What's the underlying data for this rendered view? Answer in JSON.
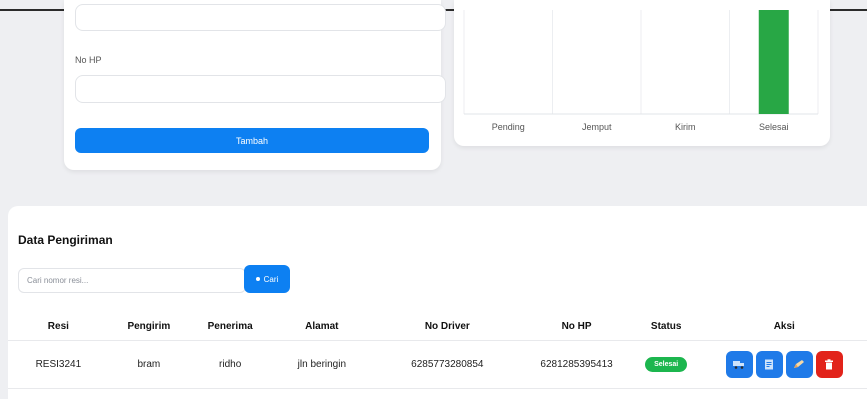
{
  "form": {
    "no_hp_label": "No HP",
    "tambah_label": "Tambah"
  },
  "chart_data": {
    "type": "bar",
    "categories": [
      "Pending",
      "Jemput",
      "Kirim",
      "Selesai"
    ],
    "values": [
      0,
      0,
      0,
      1
    ],
    "colors": [
      "#28a745",
      "#28a745",
      "#28a745",
      "#28a745"
    ],
    "title": "",
    "xlabel": "",
    "ylabel": "",
    "ylim": [
      0,
      1
    ],
    "grid": true
  },
  "data_section": {
    "title": "Data Pengiriman",
    "search_placeholder": "Cari nomor resi...",
    "search_button_label": "Cari",
    "columns": [
      "Resi",
      "Pengirim",
      "Penerima",
      "Alamat",
      "No Driver",
      "No HP",
      "Status",
      "Aksi"
    ],
    "rows": [
      {
        "resi": "RESI3241",
        "pengirim": "bram",
        "penerima": "ridho",
        "alamat": "jln beringin",
        "no_driver": "6285773280854",
        "no_hp": "6281285395413",
        "status": "Selesai",
        "actions": [
          "truck-icon",
          "document-icon",
          "edit-icon",
          "trash-icon"
        ]
      }
    ]
  },
  "colors": {
    "primary": "#0d80f2",
    "success": "#1cb64e",
    "danger": "#e2231a",
    "background": "#eeeff2"
  }
}
